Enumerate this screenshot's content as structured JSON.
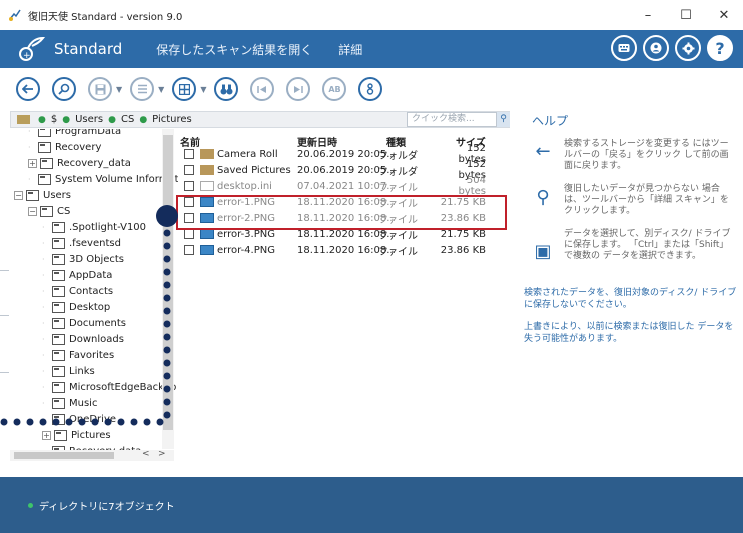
{
  "window": {
    "title": "復旧天使 Standard - version 9.0",
    "controls": [
      "–",
      "☐",
      "✕"
    ]
  },
  "header": {
    "brand": "Standard",
    "links": [
      "保存したスキャン結果を開く",
      "詳細"
    ],
    "icons": [
      "keyboard-icon",
      "account-icon",
      "settings-icon",
      "help-icon"
    ],
    "help_glyph": "?"
  },
  "toolbar": {
    "buttons": [
      "back",
      "search",
      "save",
      "list-view",
      "grid-view",
      "binoculars",
      "prev",
      "next",
      "match-case",
      "info"
    ],
    "match_case_label": "AB"
  },
  "breadcrumb": {
    "items": [
      "$",
      "Users",
      "CS",
      "Pictures"
    ],
    "search_placeholder": "クイック検索..."
  },
  "tree": {
    "items": [
      {
        "label": "ProgramData",
        "indent": 1,
        "expander": ""
      },
      {
        "label": "Recovery",
        "indent": 1,
        "expander": ""
      },
      {
        "label": "Recovery_data",
        "indent": 1,
        "expander": "+"
      },
      {
        "label": "System Volume Information",
        "indent": 1,
        "expander": ""
      },
      {
        "label": "Users",
        "indent": 0,
        "expander": "−"
      },
      {
        "label": "CS",
        "indent": 1,
        "expander": "−"
      },
      {
        "label": ".Spotlight-V100",
        "indent": 2,
        "expander": ""
      },
      {
        "label": ".fseventsd",
        "indent": 2,
        "expander": ""
      },
      {
        "label": "3D Objects",
        "indent": 2,
        "expander": ""
      },
      {
        "label": "AppData",
        "indent": 2,
        "expander": ""
      },
      {
        "label": "Contacts",
        "indent": 2,
        "expander": ""
      },
      {
        "label": "Desktop",
        "indent": 2,
        "expander": ""
      },
      {
        "label": "Documents",
        "indent": 2,
        "expander": ""
      },
      {
        "label": "Downloads",
        "indent": 2,
        "expander": ""
      },
      {
        "label": "Favorites",
        "indent": 2,
        "expander": ""
      },
      {
        "label": "Links",
        "indent": 2,
        "expander": ""
      },
      {
        "label": "MicrosoftEdgeBackup",
        "indent": 2,
        "expander": ""
      },
      {
        "label": "Music",
        "indent": 2,
        "expander": ""
      },
      {
        "label": "OneDrive",
        "indent": 2,
        "expander": ""
      },
      {
        "label": "Pictures",
        "indent": 2,
        "expander": "+"
      },
      {
        "label": "Recovery-data",
        "indent": 2,
        "expander": ""
      }
    ]
  },
  "files": {
    "columns": [
      "名前",
      "更新日時",
      "種類",
      "サイズ"
    ],
    "rows": [
      {
        "name": "Camera Roll",
        "date": "20.06.2019 20:05...",
        "type": "フォルダ",
        "size": "152 bytes",
        "icon": "folder",
        "dim": false
      },
      {
        "name": "Saved Pictures",
        "date": "20.06.2019 20:05...",
        "type": "フォルダ",
        "size": "152 bytes",
        "icon": "folder",
        "dim": false
      },
      {
        "name": "desktop.ini",
        "date": "07.04.2021 10:07...",
        "type": "ファイル",
        "size": "504 bytes",
        "icon": "ini",
        "dim": true
      },
      {
        "name": "error-1.PNG",
        "date": "18.11.2020 16:08...",
        "type": "ファイル",
        "size": "21.75 KB",
        "icon": "png",
        "dim": true
      },
      {
        "name": "error-2.PNG",
        "date": "18.11.2020 16:08...",
        "type": "ファイル",
        "size": "23.86 KB",
        "icon": "png",
        "dim": true
      },
      {
        "name": "error-3.PNG",
        "date": "18.11.2020 16:08...",
        "type": "ファイル",
        "size": "21.75 KB",
        "icon": "png",
        "dim": false
      },
      {
        "name": "error-4.PNG",
        "date": "18.11.2020 16:08...",
        "type": "ファイル",
        "size": "23.86 KB",
        "icon": "png",
        "dim": false
      }
    ]
  },
  "help": {
    "title": "ヘルプ",
    "items": [
      {
        "icon": "back-arrow-icon",
        "glyph": "←",
        "text": "検索するストレージを変更する にはツールバーの「戻る」をクリック して前の画面に戻ります。"
      },
      {
        "icon": "search-detail-icon",
        "glyph": "⚲",
        "text": "復旧したいデータが見つからない 場合は、ツールバーから「詳細 スキャン」をクリックします。"
      },
      {
        "icon": "save-disk-icon",
        "glyph": "▣",
        "text": "データを選択して、別ディスク/ ドライブに保存します。 「Ctrl」または「Shift」で複数の データを選択できます。"
      }
    ],
    "notes": [
      "検索されたデータを、復旧対象のディスク/ ドライブに保存しないでください。",
      "上書きにより、以前に検索または復旧した データを失う可能性があります。"
    ]
  },
  "status": {
    "text": "ディレクトリに7オブジェクト"
  },
  "colors": {
    "brand_blue": "#2d6ba8",
    "status_bg": "#2d5d8c",
    "highlight_red": "#c0202a",
    "annotation_navy": "#142c5c"
  }
}
